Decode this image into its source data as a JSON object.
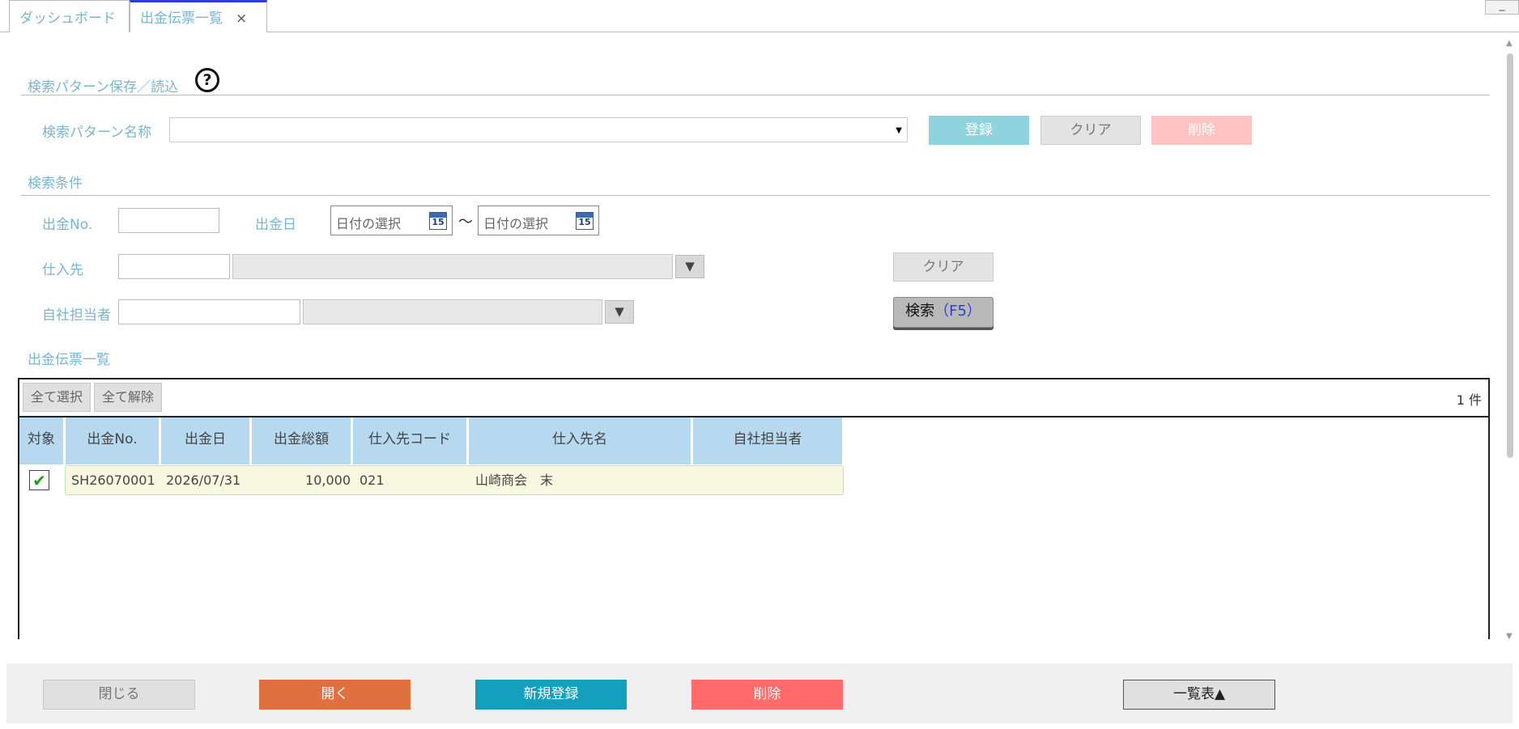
{
  "tabs": [
    {
      "label": "ダッシュボード"
    },
    {
      "label": "出金伝票一覧",
      "close": "×"
    }
  ],
  "window": {
    "minimize": "_"
  },
  "pattern": {
    "section_title": "検索パターン保存／読込",
    "help": "?",
    "name_label": "検索パターン名称",
    "name_value": "",
    "register_label": "登録",
    "clear_label": "クリア",
    "delete_label": "削除"
  },
  "conditions": {
    "section_title": "検索条件",
    "slip_no_label": "出金No.",
    "slip_no_value": "",
    "date_label": "出金日",
    "date_from_placeholder": "日付の選択",
    "date_to_placeholder": "日付の選択",
    "calendar_day": "15",
    "tilde": "～",
    "supplier_label": "仕入先",
    "staff_label": "自社担当者",
    "clear_label": "クリア",
    "search_label": "検索",
    "search_key": "（F5）"
  },
  "list": {
    "section_title": "出金伝票一覧",
    "select_all": "全て選択",
    "deselect_all": "全て解除",
    "count": "1 件",
    "columns": [
      "対象",
      "出金No.",
      "出金日",
      "出金総額",
      "仕入先コード",
      "仕入先名",
      "自社担当者"
    ],
    "rows": [
      {
        "checked": true,
        "check_mark": "✔",
        "no": "SH26070001",
        "date": "2026/07/31",
        "amount": "10,000",
        "supplier_code": "021",
        "supplier_name": "山崎商会　末",
        "staff": ""
      }
    ]
  },
  "footer": {
    "close": "閉じる",
    "open": "開く",
    "new": "新規登録",
    "delete": "削除",
    "list": "一覧表▲"
  },
  "colors": {
    "accent_label": "#7ab5cf",
    "open": "#e07040",
    "new": "#14a0bd",
    "delete": "#ff6b6b",
    "header": "#b6d9ef"
  }
}
